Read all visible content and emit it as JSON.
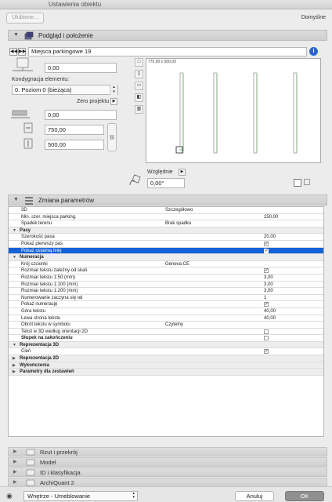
{
  "window": {
    "title": "Ustawienia obiektu"
  },
  "topbar": {
    "favorites_label": "Ulubione...",
    "default_label": "Domyślne"
  },
  "preview_section": {
    "title": "Podgląd i położenie",
    "object_name": "Miejsca parkingowe 19",
    "elevation_value": "0,00",
    "story_label": "Kondygnacja elementu:",
    "story_value": "0. Poziom 0 (bieżąca)",
    "project_zero_label": "Zero projektu",
    "offset_value": "0,00",
    "width_value": "750,00",
    "depth_value": "500,00",
    "preview_size_label": "770,00 x 500,00",
    "relative_label": "Względnie",
    "angle_value": "0,00°"
  },
  "params_section": {
    "title": "Zmiana parametrów",
    "rows": [
      {
        "type": "value",
        "name": "3D",
        "value": "Szczegółowo",
        "number": ""
      },
      {
        "type": "value",
        "name": "Min. szer. miejsca parking.",
        "value": "",
        "number": "250,00"
      },
      {
        "type": "value",
        "name": "Spadek terenu",
        "value": "Brak spadku",
        "number": ""
      },
      {
        "type": "group",
        "name": "Pasy"
      },
      {
        "type": "value",
        "name": "Szerokość pasa",
        "value": "",
        "number": "20,00"
      },
      {
        "type": "check",
        "name": "Pokaż pierwszy pas",
        "checked": true
      },
      {
        "type": "check",
        "name": "Pokaż ostatnią linię",
        "checked": true,
        "selected": true
      },
      {
        "type": "group",
        "name": "Numeracja"
      },
      {
        "type": "value",
        "name": "Krój czcionki",
        "value": "Geneva CE",
        "number": ""
      },
      {
        "type": "check",
        "name": "Rozmiar tekstu zależny od skali",
        "checked": true
      },
      {
        "type": "value",
        "name": "Rozmiar tekstu 1:50 (mm)",
        "value": "",
        "number": "3,00"
      },
      {
        "type": "value",
        "name": "Rozmiar tekstu 1:100 (mm)",
        "value": "",
        "number": "3,00"
      },
      {
        "type": "value",
        "name": "Rozmiar tekstu 1:200 (mm)",
        "value": "",
        "number": "3,00"
      },
      {
        "type": "value",
        "name": "Numerowanie zaczyna się od",
        "value": "",
        "number": "1"
      },
      {
        "type": "check",
        "name": "Pokaż numerację",
        "checked": true
      },
      {
        "type": "value",
        "name": "Góra tekstu",
        "value": "",
        "number": "40,00"
      },
      {
        "type": "value",
        "name": "Lewa strona tekstu",
        "value": "",
        "number": "40,00"
      },
      {
        "type": "value",
        "name": "Obrót tekstu w symbolu",
        "value": "Czytelny",
        "number": ""
      },
      {
        "type": "check",
        "name": "Tekst w 3D według orientacji 2D",
        "checked": false
      },
      {
        "type": "check",
        "name": "Słupek na zakończeniu",
        "checked": false,
        "bold": true
      },
      {
        "type": "group",
        "name": "Reprezentacja 3D"
      },
      {
        "type": "check",
        "name": "Cień",
        "checked": true
      },
      {
        "type": "group",
        "name": "Reprezentacja 2D",
        "collapsed": true
      },
      {
        "type": "group",
        "name": "Wykończenia",
        "collapsed": true
      },
      {
        "type": "group",
        "name": "Parametry dla zestawień",
        "collapsed": true
      }
    ]
  },
  "collapsed_sections": [
    {
      "label": "Rzut i przekrój",
      "icon": "plan-section-icon"
    },
    {
      "label": "Model",
      "icon": "model-icon"
    },
    {
      "label": "ID i klasyfikacja",
      "icon": "id-classification-icon"
    },
    {
      "label": "ArchiQuant 2",
      "icon": "archiquant-icon"
    }
  ],
  "bottom": {
    "layer_value": "Wnętrze - Umeblowanie",
    "cancel_label": "Anuluj",
    "ok_label": "OK"
  },
  "colors": {
    "selection": "#1462d6",
    "ok_button": "#8f8f8f"
  }
}
